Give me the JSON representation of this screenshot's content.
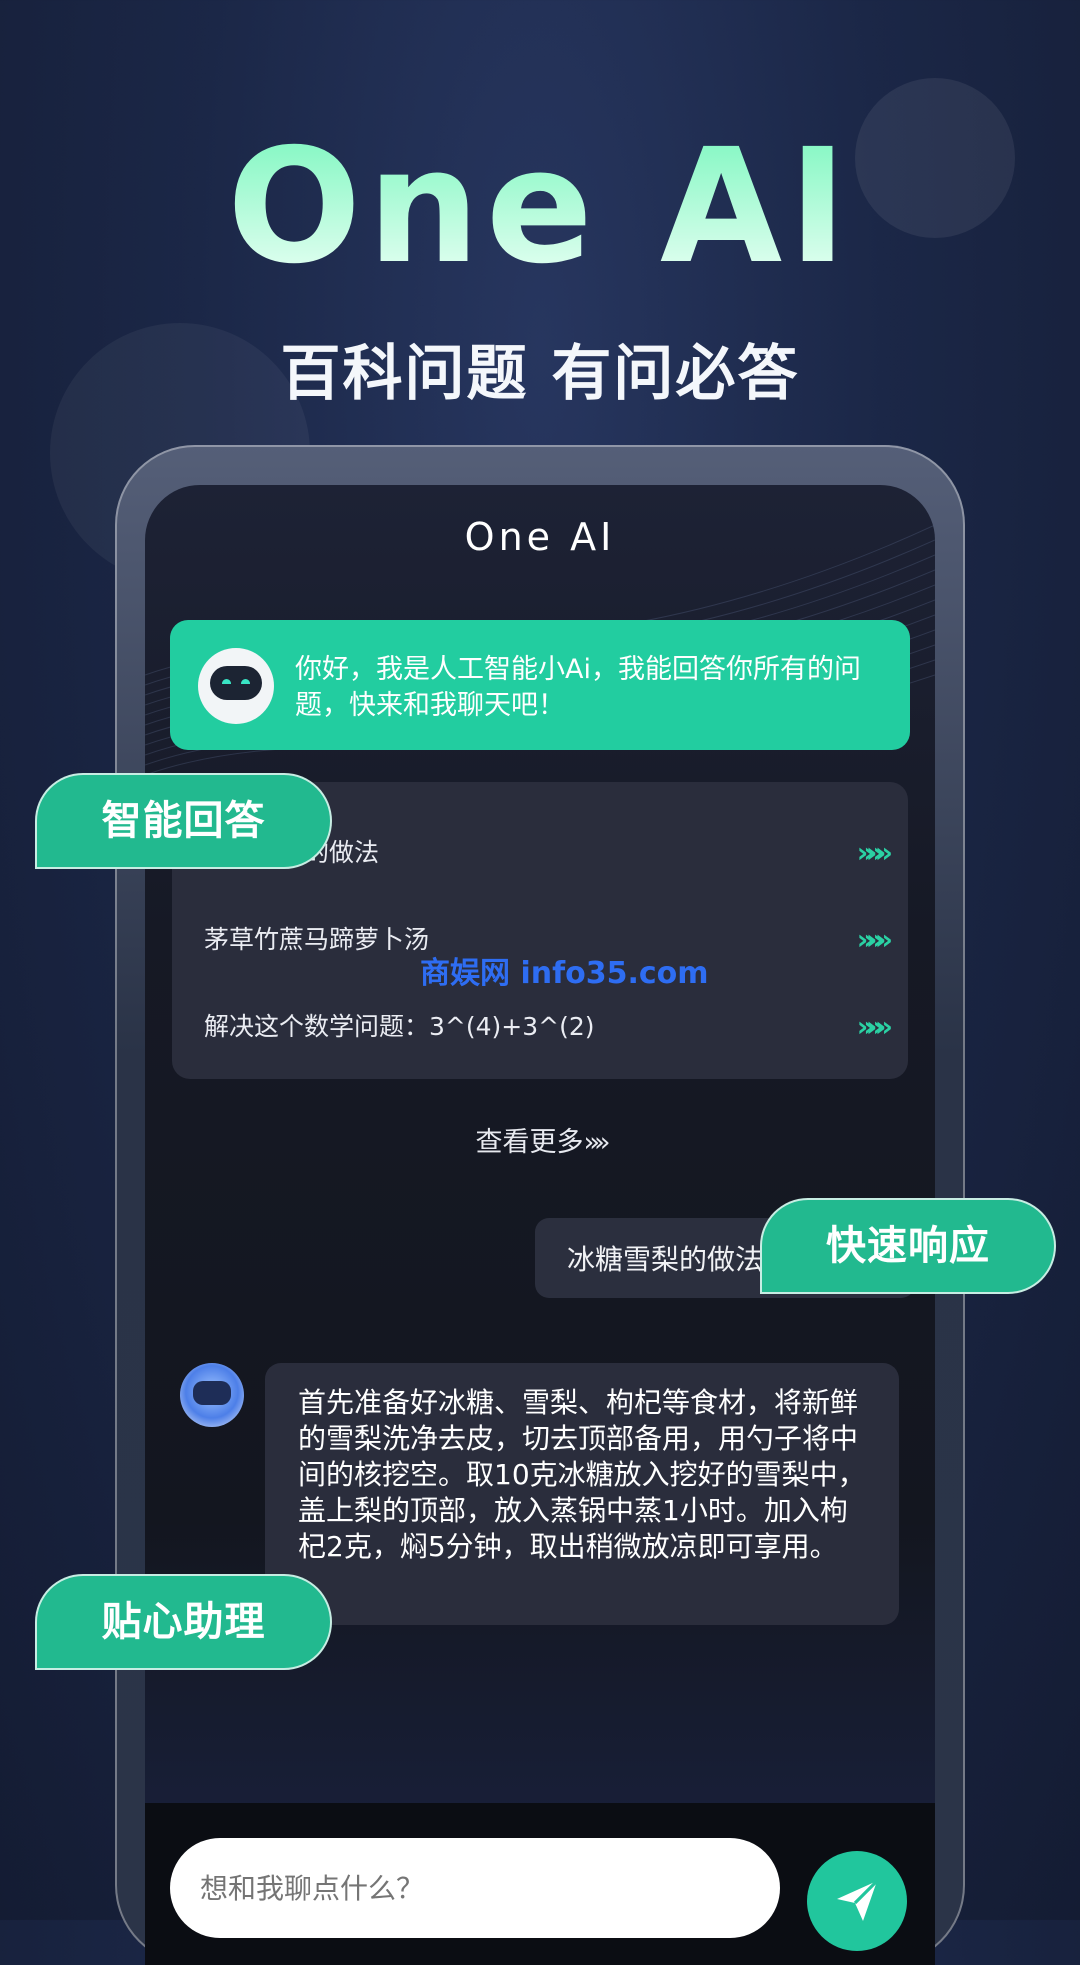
{
  "hero": {
    "title": "One AI",
    "subtitle": "百科问题 有问必答"
  },
  "app": {
    "title": "One AI",
    "greeting": "你好，我是人工智能小Ai，我能回答你所有的问题，快来和我聊天吧！",
    "suggestions": [
      {
        "label": "冰糖雪梨的做法",
        "chevron": "»»»"
      },
      {
        "label": "茅草竹蔗马蹄萝卜汤",
        "chevron": "»»»"
      },
      {
        "label": "解决这个数学问题：3^(4)+3^(2)",
        "chevron": "»»»"
      }
    ],
    "see_more": "查看更多",
    "see_more_arrow": "»»",
    "user_message": "冰糖雪梨的做法",
    "answer": "首先准备好冰糖、雪梨、枸杞等食材，将新鲜的雪梨洗净去皮，切去顶部备用，用勺子将中间的核挖空。取10克冰糖放入挖好的雪梨中，盖上梨的顶部，放入蒸锅中蒸1小时。加入枸杞2克，焖5分钟，取出稍微放凉即可享用。",
    "input_placeholder": "想和我聊点什么？"
  },
  "tags": {
    "smart_answer": "智能回答",
    "fast_response": "快速响应",
    "assistant": "贴心助理"
  },
  "watermark": "商娱网 info35.com",
  "colors": {
    "accent": "#22cda0",
    "background": "#1b2747"
  },
  "icons": {
    "send": "send-icon",
    "bot": "robot-avatar-icon"
  }
}
